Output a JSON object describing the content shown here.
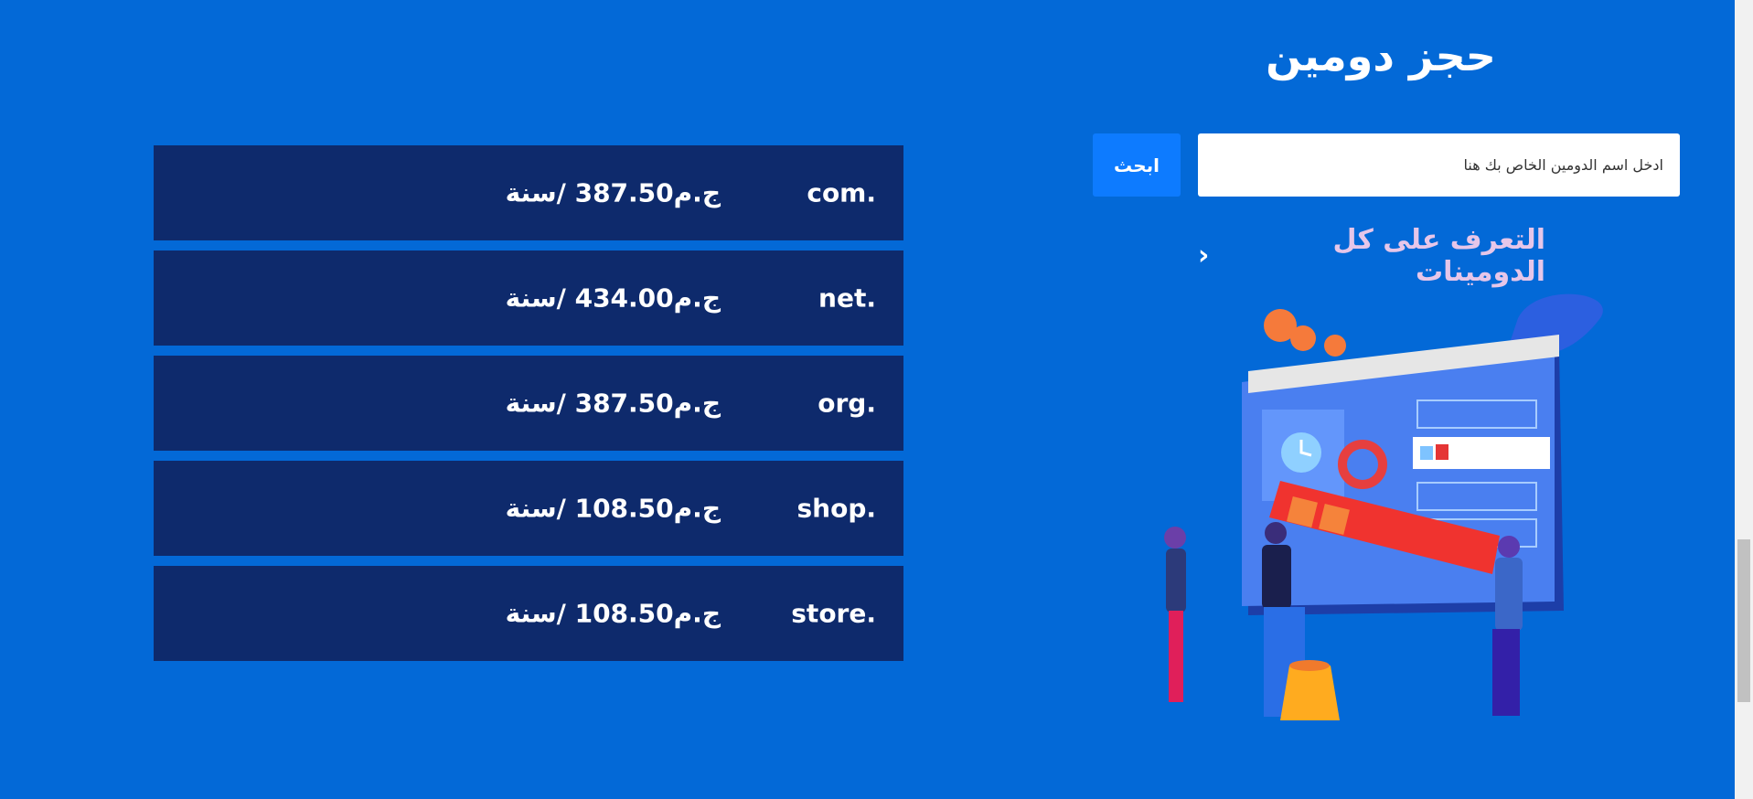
{
  "domain_search": {
    "title": "حجز دومين",
    "input_placeholder": "ادخل اسم الدومين الخاص بك هنا",
    "button_label": "ابحث",
    "learn_all_link": "التعرف على كل الدومينات"
  },
  "prices": [
    {
      "tld": "com.",
      "price": "ج.م387.50 /سنة"
    },
    {
      "tld": "net.",
      "price": "ج.م434.00 /سنة"
    },
    {
      "tld": "org.",
      "price": "ج.م387.50 /سنة"
    },
    {
      "tld": "shop.",
      "price": "ج.م108.50 /سنة"
    },
    {
      "tld": "store.",
      "price": "ج.م108.50 /سنة"
    }
  ],
  "colors": {
    "background": "#0369d7",
    "row_background": "#0e2a6c",
    "button": "#0d7bff",
    "link": "#e6c6e9"
  }
}
